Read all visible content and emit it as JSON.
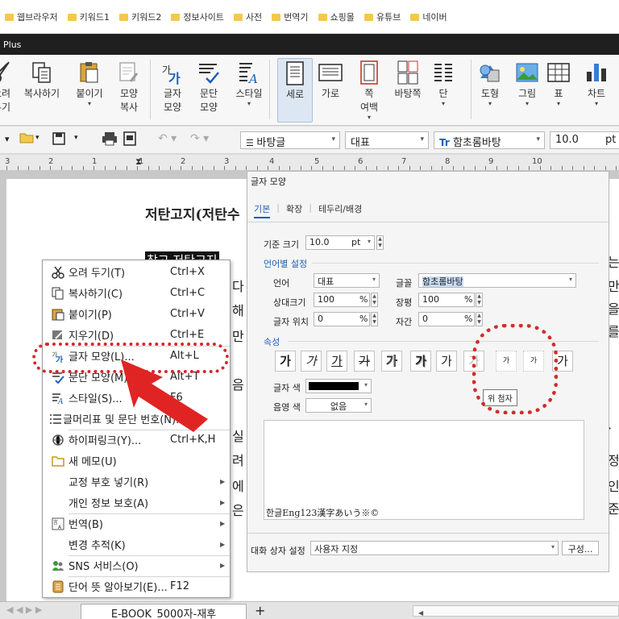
{
  "bookmarks": [
    "웹브라우저",
    "키워드1",
    "키워드2",
    "정보사이트",
    "사전",
    "번역기",
    "쇼핑몰",
    "유튜브",
    "네이버"
  ],
  "window": {
    "title": "Plus"
  },
  "ribbon": {
    "buttons": [
      {
        "label": "오려\n두기"
      },
      {
        "label": "복사하기"
      },
      {
        "label": "붙이기"
      },
      {
        "label": "모양\n복사"
      },
      {
        "label": "글자\n모양"
      },
      {
        "label": "문단\n모양"
      },
      {
        "label": "스타일"
      },
      {
        "label": "세로"
      },
      {
        "label": "가로"
      },
      {
        "label": "쪽\n여백"
      },
      {
        "label": "바탕쪽"
      },
      {
        "label": "단"
      },
      {
        "label": "도형"
      },
      {
        "label": "그림"
      },
      {
        "label": "표"
      },
      {
        "label": "차트"
      }
    ]
  },
  "toolbar": {
    "style": "바탕글",
    "lang": "대표",
    "font": "함초롬바탕",
    "size": "10.0",
    "unit": "pt"
  },
  "ruler": {
    "labels": [
      "3",
      "2",
      "1",
      "1",
      "2",
      "3",
      "4",
      "5",
      "6",
      "7",
      "8",
      "9",
      "10"
    ]
  },
  "document": {
    "title": "저탄고지(저탄수",
    "selected_line": "참고 저탄고지",
    "right_fragments": [
      "는",
      "만",
      "을",
      "를",
      "·",
      "정",
      "인",
      "준"
    ],
    "body_fragments": [
      "다",
      "해",
      "만",
      "음",
      "실",
      "려",
      "에",
      "은"
    ]
  },
  "context_menu": {
    "items": [
      {
        "label": "오려 두기(T)",
        "shortcut": "Ctrl+X"
      },
      {
        "label": "복사하기(C)",
        "shortcut": "Ctrl+C"
      },
      {
        "label": "붙이기(P)",
        "shortcut": "Ctrl+V"
      },
      {
        "label": "지우기(D)",
        "shortcut": "Ctrl+E"
      },
      {
        "label": "글자 모양(L)...",
        "shortcut": "Alt+L"
      },
      {
        "label": "문단 모양(M)...",
        "shortcut": "Alt+T"
      },
      {
        "label": "스타일(S)...",
        "shortcut": "F6"
      },
      {
        "label": "글머리표 및 문단 번호(N)...",
        "shortcut": ""
      },
      {
        "label": "하이퍼링크(Y)...",
        "shortcut": "Ctrl+K,H"
      },
      {
        "label": "새 메모(U)",
        "shortcut": ""
      },
      {
        "label": "교정 부호 넣기(R)",
        "shortcut": ""
      },
      {
        "label": "개인 정보 보호(A)",
        "shortcut": ""
      },
      {
        "label": "번역(B)",
        "shortcut": ""
      },
      {
        "label": "변경 추적(K)",
        "shortcut": ""
      },
      {
        "label": "SNS 서비스(O)",
        "shortcut": ""
      },
      {
        "label": "단어 뜻 알아보기(E)...",
        "shortcut": "F12"
      }
    ]
  },
  "dialog": {
    "title": "글자 모양",
    "tabs": [
      "기본",
      "확장",
      "테두리/배경"
    ],
    "base_size_label": "기준 크기",
    "base_size": "10.0",
    "base_size_unit": "pt",
    "lang_section": "언어별 설정",
    "lang_label": "언어",
    "lang_value": "대표",
    "font_label": "글꼴",
    "font_value": "함초롬바탕",
    "relsize_label": "상대크기",
    "relsize_value": "100",
    "width_label": "장평",
    "width_value": "100",
    "pos_label": "글자 위치",
    "pos_value": "0",
    "spacing_label": "자간",
    "spacing_value": "0",
    "percent": "%",
    "attr_section": "속성",
    "format_buttons": [
      "가",
      "가",
      "가",
      "가",
      "가",
      "가",
      "가",
      "가",
      "가",
      "가",
      "가"
    ],
    "text_color_label": "글자 색",
    "shade_color_label": "음영 색",
    "shade_color_value": "없음",
    "tooltip": "위 첨자",
    "preview_text": "한글Eng123漢字あいう※©",
    "dialog_setting_label": "대화 상자 설정",
    "dialog_setting_value": "사용자 지정",
    "config_button": "구성..."
  },
  "bottom": {
    "tab": "E-BOOK_5000자-재후",
    "add": "+"
  }
}
